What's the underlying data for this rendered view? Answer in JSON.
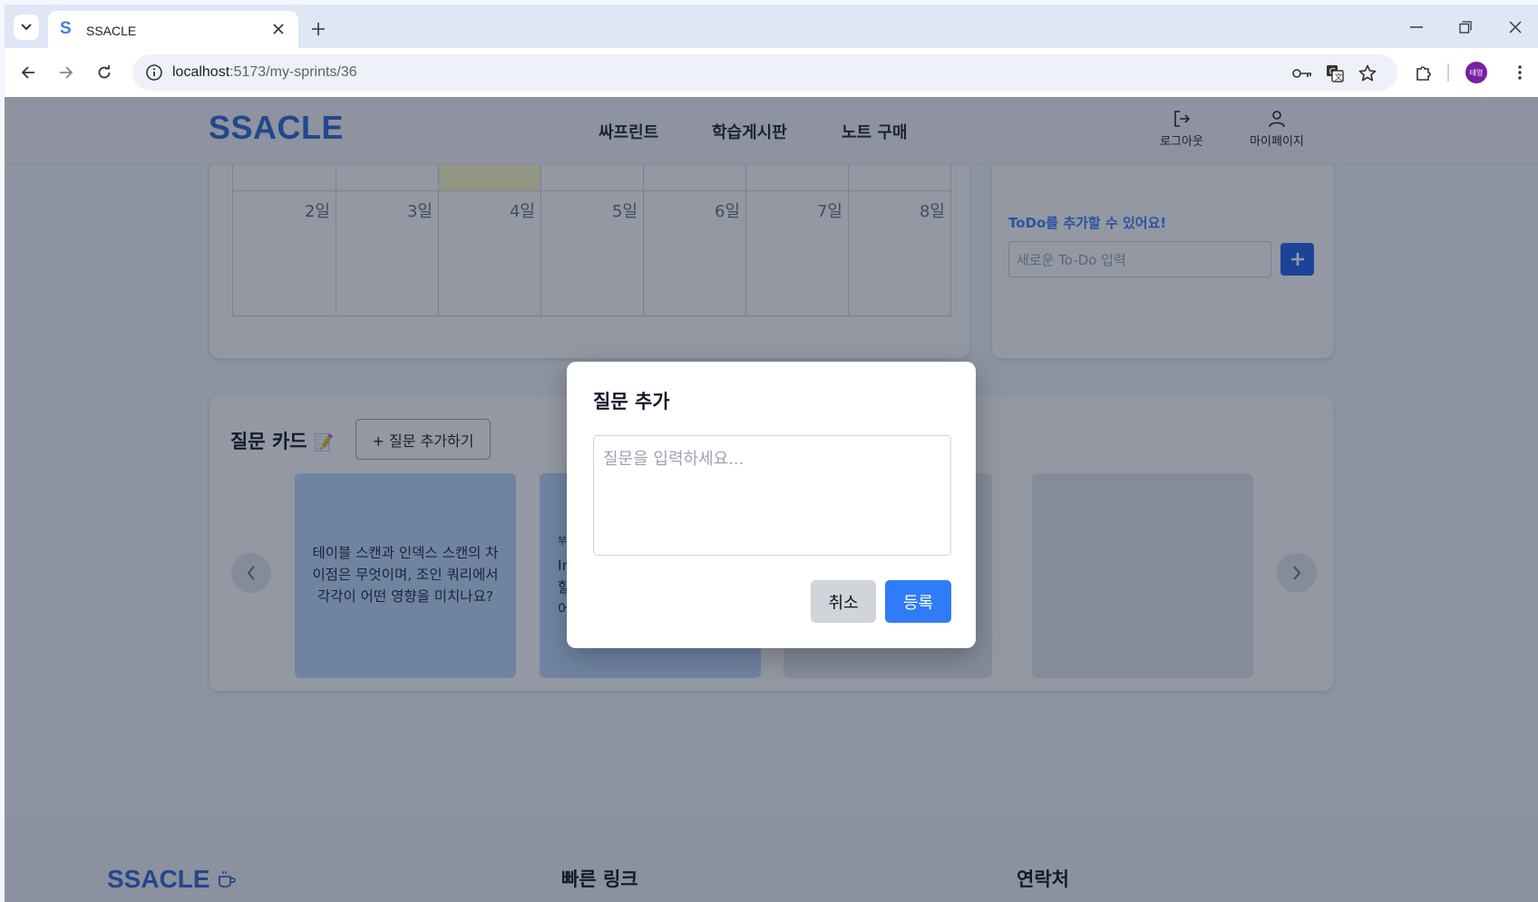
{
  "browser": {
    "tab_title": "SSACLE",
    "tab_favicon": "S",
    "url_host": "localhost",
    "url_rest": ":5173/my-sprints/36",
    "profile_initials": "태영",
    "accent": "#3f7de6"
  },
  "header": {
    "logo": "SSACLE",
    "nav": [
      "싸프린트",
      "학습게시판",
      "노트 구매"
    ],
    "logout_label": "로그아웃",
    "mypage_label": "마이페이지"
  },
  "calendar": {
    "days": [
      "2일",
      "3일",
      "4일",
      "5일",
      "6일",
      "7일",
      "8일"
    ],
    "highlight_color": "#fef9c3"
  },
  "todo": {
    "hint": "ToDo를 추가할 수 있어요!",
    "placeholder": "새로운 To-Do 입력"
  },
  "questions": {
    "title": "질문 카드",
    "title_icon": "📝",
    "add_button": "+ 질문 추가하기",
    "cards": [
      {
        "text": "테이블 스캔과 인덱스 스캔의 차이점은 무엇이며, 조인 쿼리에서 각각이 어떤 영향을 미치나요?",
        "color": "#bfdbfe"
      },
      {
        "text": "",
        "color": "#bfdbfe"
      },
      {
        "text": "",
        "color": "#e5e7eb"
      },
      {
        "text": "",
        "color": "#e5e7eb"
      }
    ],
    "partial_card_text": [
      "부",
      "In",
      "할",
      "어"
    ]
  },
  "footer": {
    "logo": "SSACLE",
    "quick_links": "빠른 링크",
    "contact": "연락처"
  },
  "modal": {
    "title": "질문 추가",
    "placeholder": "질문을 입력하세요...",
    "cancel": "취소",
    "submit": "등록",
    "submit_color": "#2f7cf6"
  }
}
